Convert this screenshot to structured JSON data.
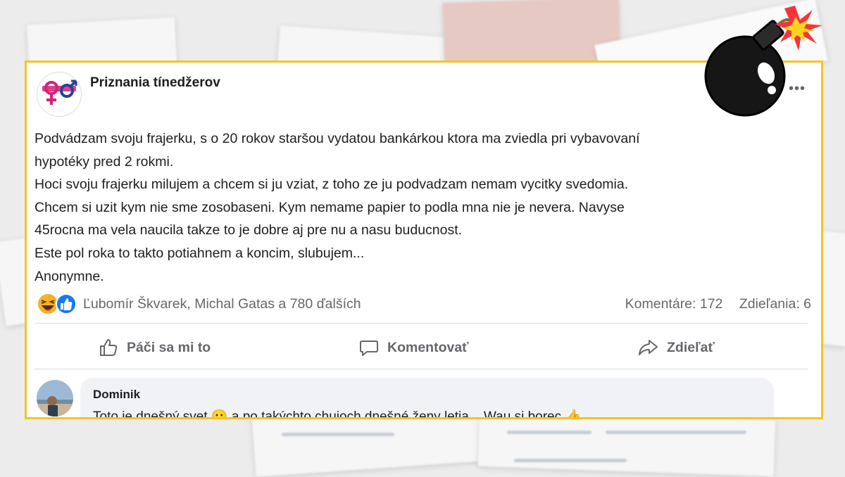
{
  "post": {
    "page_name": "Priznania tínedžerov",
    "more_icon": "ellipsis-icon",
    "text_lines": [
      "Podvádzam svoju frajerku, s o 20 rokov staršou vydatou bankárkou ktora ma zviedla pri vybavovaní",
      "hypotéky pred 2 rokmi.",
      "Hoci svoju frajerku milujem a chcem si ju vziat, z toho ze ju podvadzam nemam vycitky svedomia.",
      "Chcem si uzit kym nie sme zosobaseni. Kym nemame papier to podla mna nie je nevera. Navyse",
      "45rocna ma vela naucila takze to je dobre aj pre nu a nasu buducnost.",
      "Este pol roka to takto potiahnem a koncim, slubujem...",
      "Anonymne."
    ],
    "reaction_icons": [
      "haha-emoji-icon",
      "like-thumb-icon"
    ],
    "reactors": "Ľubomír Škvarek, Michal Gatas a 780 ďalších",
    "comments_count": "Komentáre: 172",
    "shares_count": "Zdieľania: 6"
  },
  "actions": {
    "like": "Páči sa mi to",
    "comment": "Komentovať",
    "share": "Zdieľať"
  },
  "comment": {
    "author": "Dominik",
    "text": "Toto je dnešný svet 😐 a po takýchto chujoch dnešné ženy letia... Wau si borec 👍"
  },
  "colors": {
    "frame": "#f7c325",
    "brand_pink": "#d6207a",
    "brand_blue": "#2d3e9a",
    "like_blue": "#1877f2",
    "muted_text": "#65676b"
  },
  "decor": {
    "bomb_icon": "bomb-icon"
  }
}
